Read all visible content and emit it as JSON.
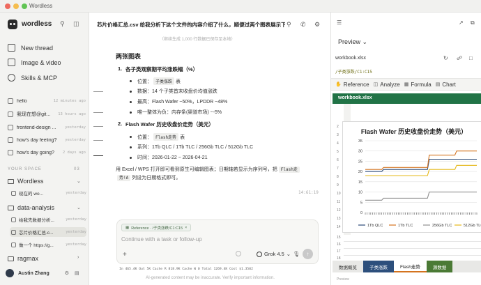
{
  "window": {
    "title": "Wordless"
  },
  "sidebar": {
    "brand": "wordless",
    "nav": [
      {
        "label": "New thread",
        "icon": "edit-icon"
      },
      {
        "label": "Image & video",
        "icon": "image-icon"
      },
      {
        "label": "Skills & MCP",
        "icon": "skills-icon"
      }
    ],
    "history": [
      {
        "title": "hello",
        "time": "12 minutes ago"
      },
      {
        "title": "我现在想@git...",
        "time": "13 hours ago"
      },
      {
        "title": "frontend-design ...",
        "time": "yesterday"
      },
      {
        "title": "how's day feeling?",
        "time": "yesterday"
      },
      {
        "title": "how's day going?",
        "time": "2 days ago"
      }
    ],
    "space_label": "YOUR SPACE",
    "space_count": "03",
    "folders": [
      {
        "name": "Wordless",
        "items": [
          {
            "title": "现在的 wo...",
            "time": "yesterday"
          }
        ]
      },
      {
        "name": "data-analysis",
        "items": [
          {
            "title": "给我先数据分析...",
            "time": "yesterday"
          },
          {
            "title": "芯片价格汇总.c...",
            "time": "yesterday",
            "active": true
          },
          {
            "title": "做一个 https://g...",
            "time": "yesterday"
          }
        ]
      },
      {
        "name": "ragmax",
        "items": []
      }
    ],
    "user": "Austin Zhang"
  },
  "conversation": {
    "title": "芯片价格汇总.csv 给我分析下这个文件的内容介绍了什么，顺便过两个图表展示下数据",
    "cut_text": "（继续生成 1,000 行数据已保存至本地）",
    "heading": "两张图表",
    "items": [
      {
        "num": "1.",
        "title": "各子类观察期平均涨跌幅（%）",
        "bullets": [
          {
            "label": "位置：",
            "code": "子类涨跌",
            "after": "表"
          },
          {
            "text": "数据：14 个子类首末收盘价均值涨跌"
          },
          {
            "text": "最高：Flash Wafer ~50%，LPDDR ~48%"
          },
          {
            "text": "唯一整体为负：内存条(渠道市场) ~-5%"
          }
        ]
      },
      {
        "num": "2.",
        "title": "Flash Wafer 历史收盘价走势（美元）",
        "bullets": [
          {
            "label": "位置：",
            "code": "Flash走势",
            "after": "表"
          },
          {
            "text": "系列：1Tb QLC / 1Tb TLC / 256Gb TLC / 512Gb TLC"
          },
          {
            "text": "时间：2026-01-22 ~ 2026-04-21"
          }
        ]
      }
    ],
    "para_1": "用 Excel / WPS 打开即可看到原生可编辑图表；日期轴若显示为序列号，把",
    "para_code_1": "Flash走",
    "para_code_2": "势!A",
    "para_2": "列设为日期格式即可。",
    "timestamp": "14:61:19"
  },
  "composer": {
    "chip": "Reference · /子类涨跌/C1:C15",
    "placeholder": "Continue with a task or follow-up",
    "model": "Grok 4.5"
  },
  "stats": {
    "text": "In 465.4K   Out 5K   Cache R 818.9K   Cache W 0   Total 1269.4K   Cost $1.3502"
  },
  "disclaimer": "AI-generated content may be inaccurate. Verify important information.",
  "panel": {
    "mode": "Preview",
    "file": "workbook.xlsx",
    "path": "/子类涨跌/C1:C15",
    "ribbon": [
      {
        "label": "Reference",
        "icon": "hand-icon"
      },
      {
        "label": "Analyze",
        "icon": "analyze-icon"
      },
      {
        "label": "Formula",
        "icon": "formula-icon"
      },
      {
        "label": "Chart",
        "icon": "chart-icon"
      }
    ],
    "workbook_title": "workbook.xlsx",
    "rows_top": [
      "2",
      "3",
      "4",
      "5",
      "6",
      "7",
      "8",
      "9",
      "10",
      "11",
      "12",
      "13",
      "14"
    ],
    "rows_bottom": [
      "15",
      "16",
      "17",
      "18"
    ],
    "sheets": [
      {
        "name": "数据概览",
        "bg": "#e8e8e6",
        "color": "#333"
      },
      {
        "name": "子类涨跌",
        "bg": "#2d4f7c",
        "color": "#fff"
      },
      {
        "name": "Flash走势",
        "bg": "#ffffff",
        "color": "#222",
        "active": true
      },
      {
        "name": "源数据",
        "bg": "#4b7a35",
        "color": "#fff"
      }
    ],
    "footer": "Preview"
  },
  "chart_data": {
    "type": "line",
    "title": "Flash Wafer 历史收盘价走势（美元）",
    "ylim": [
      0,
      35
    ],
    "yticks": [
      0,
      5,
      10,
      15,
      20,
      25,
      30,
      35
    ],
    "x_count": 62,
    "legend_position": "bottom",
    "series": [
      {
        "name": "1Tb QLC",
        "color": "#2b4a77",
        "values": [
          20,
          20,
          20,
          20,
          20,
          20,
          20,
          20,
          20,
          20,
          21,
          21,
          21,
          21,
          21,
          21,
          21,
          21,
          21,
          21,
          21,
          21,
          21,
          21,
          21,
          21,
          21,
          21,
          21,
          21,
          21,
          21,
          21,
          21,
          21,
          26,
          26,
          26,
          26,
          26,
          26,
          26,
          26,
          26,
          26,
          26,
          26,
          26,
          26,
          26,
          26,
          26,
          26,
          26,
          26,
          26,
          26,
          26,
          26,
          26,
          26,
          26
        ]
      },
      {
        "name": "1Tb TLC",
        "color": "#d4731f",
        "values": [
          21,
          21,
          21,
          21,
          21,
          21,
          21,
          21,
          21,
          21,
          22,
          22,
          22,
          22,
          22,
          22,
          22,
          22,
          22,
          22,
          22,
          22,
          22,
          22,
          22,
          22,
          22,
          22,
          22,
          22,
          22,
          22,
          22,
          22,
          22,
          28,
          28,
          28,
          28,
          28,
          28,
          28,
          28,
          28,
          28,
          28,
          28,
          28,
          28,
          28,
          30,
          30,
          30,
          30,
          30,
          30,
          30,
          30,
          30,
          30,
          30,
          30
        ]
      },
      {
        "name": "256Gb TLC",
        "color": "#8f8f8f",
        "values": [
          6,
          6,
          6,
          6,
          6,
          6,
          6,
          6,
          6,
          6,
          7,
          7,
          7,
          7,
          7,
          7,
          7,
          7,
          7,
          7,
          7,
          7,
          7,
          7,
          7,
          7,
          7,
          7,
          7,
          7,
          7,
          7,
          7,
          7,
          7,
          10,
          10,
          10,
          10,
          10,
          10,
          10,
          10,
          10,
          10,
          10,
          10,
          10,
          10,
          10,
          10,
          10,
          10,
          10,
          10,
          10,
          10,
          10,
          10,
          10,
          10,
          10
        ]
      },
      {
        "name": "512Gb TLC",
        "color": "#e5b818",
        "values": [
          18,
          18,
          18,
          18,
          18,
          18,
          18,
          18,
          18,
          18,
          18,
          18,
          18,
          18,
          18,
          18,
          18,
          18,
          18,
          18,
          18,
          18,
          18,
          18,
          18,
          18,
          18,
          18,
          18,
          18,
          18,
          18,
          18,
          18,
          18,
          21,
          21,
          21,
          21,
          21,
          21,
          21,
          21,
          21,
          21,
          21,
          21,
          21,
          21,
          21,
          23,
          23,
          23,
          23,
          23,
          23,
          23,
          23,
          23,
          23,
          23,
          23
        ]
      }
    ]
  }
}
